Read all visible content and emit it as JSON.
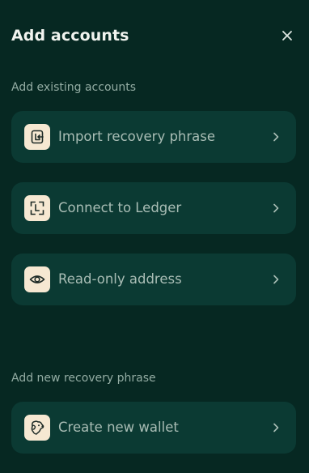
{
  "header": {
    "title": "Add accounts",
    "close_icon": "close-icon"
  },
  "sections": {
    "existing_label": "Add existing accounts",
    "new_label": "Add new recovery phrase"
  },
  "rows": [
    {
      "label": "Import recovery phrase",
      "icon": "import-icon"
    },
    {
      "label": "Connect to Ledger",
      "icon": "ledger-icon"
    },
    {
      "label": "Read-only address",
      "icon": "eye-icon"
    },
    {
      "label": "Create new wallet",
      "icon": "dog-icon"
    }
  ],
  "colors": {
    "background": "#062822",
    "row_background": "#0b3a33",
    "icon_background": "#f6e8d2",
    "label": "#a9bdb5",
    "section_label": "#93aca3"
  }
}
